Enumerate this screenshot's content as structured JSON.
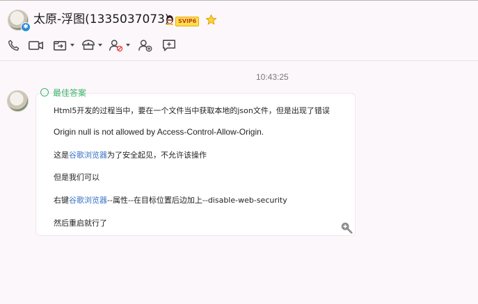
{
  "header": {
    "contact_name": "太原-浮图(1335037073)",
    "vip_label": "SVIP6",
    "avatar_badge": "✱"
  },
  "toolbar": {
    "icons": [
      "phone-icon",
      "video-call-icon",
      "share-screen-icon",
      "remote-assist-icon",
      "block-user-icon",
      "add-contact-icon",
      "new-message-icon"
    ]
  },
  "chat": {
    "timestamp": "10:43:25",
    "header_text": "最佳答案",
    "lines": {
      "l1": "Html5开发的过程当中，要在一个文件当中获取本地的json文件，但是出现了错误",
      "l2": "Origin null is not allowed by Access-Control-Allow-Origin.",
      "l3_pre": "这是",
      "l3_link": "谷歌浏览器",
      "l3_post": "为了安全起见，不允许该操作",
      "l4": "但是我们可以",
      "l5_pre": "右键",
      "l5_link": "谷歌浏览器",
      "l5_post": "--属性--在目标位置后边加上--disable-web-security",
      "l6": "然后重启就行了"
    }
  },
  "colors": {
    "link": "#3b73c6",
    "accent_green": "#3cb46a",
    "background": "#fcf7fa"
  }
}
